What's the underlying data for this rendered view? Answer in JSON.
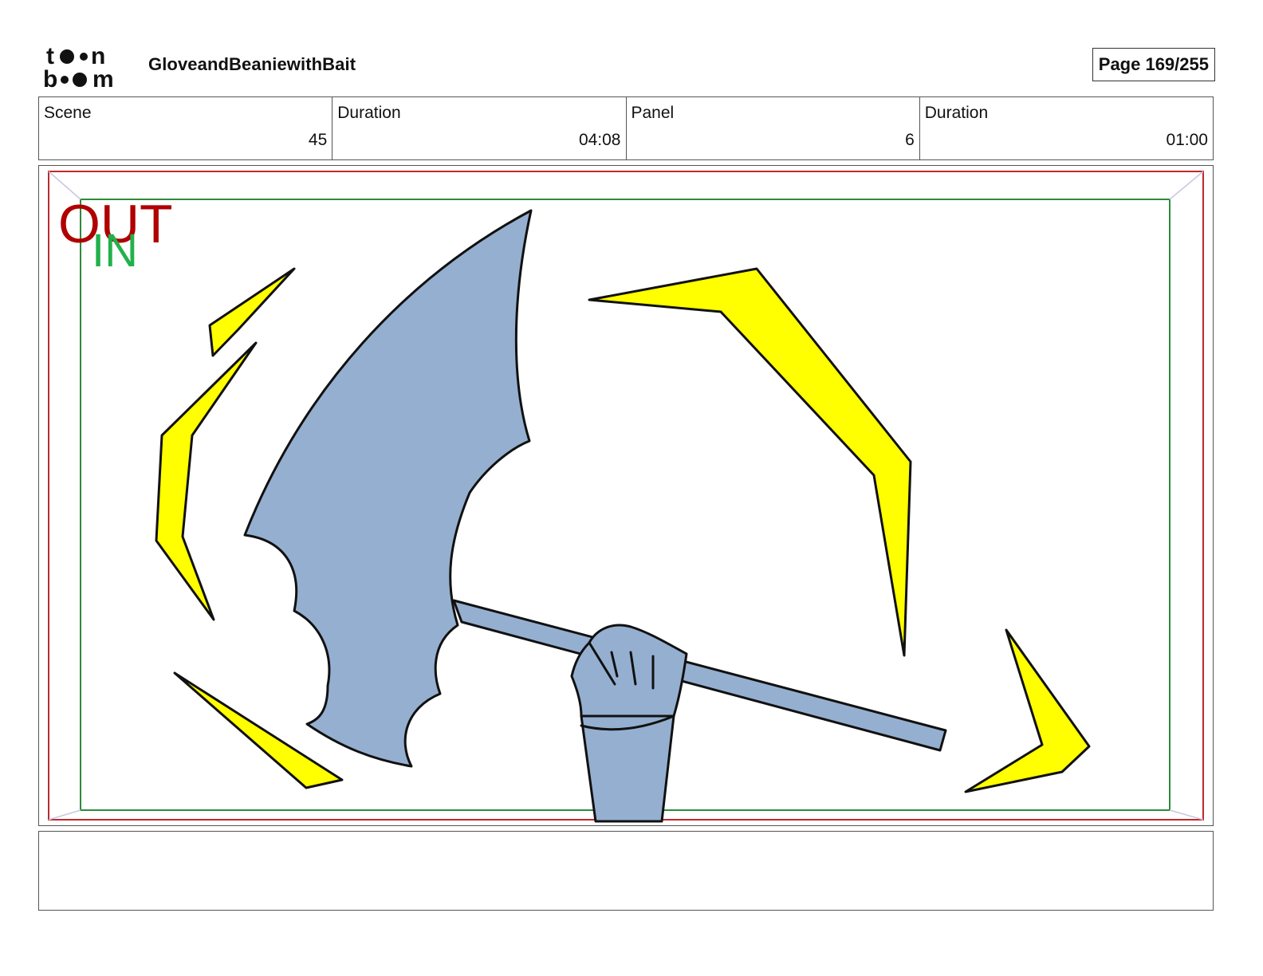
{
  "header": {
    "logo_text_top": "toon",
    "logo_text_bottom": "boom",
    "project_title": "GloveandBeaniewithBait",
    "page_label": "Page 169/255"
  },
  "info_bar": [
    {
      "label": "Scene",
      "value": "45"
    },
    {
      "label": "Duration",
      "value": "04:08"
    },
    {
      "label": "Panel",
      "value": "6"
    },
    {
      "label": "Duration",
      "value": "01:00"
    }
  ],
  "panel": {
    "out_label": "OUT",
    "in_label": "IN",
    "colors": {
      "out_frame": "#c0282f",
      "in_frame": "#2e8b3a",
      "out_text": "#b00000",
      "in_text": "#22b14c",
      "axe_fill": "#95afd0",
      "burst_fill": "#ffff00",
      "ink": "#111111"
    },
    "drawing_elements": [
      "axe-blade",
      "axe-handle",
      "fist",
      "forearm",
      "yellow-action-bursts"
    ]
  },
  "caption": {
    "text": ""
  }
}
